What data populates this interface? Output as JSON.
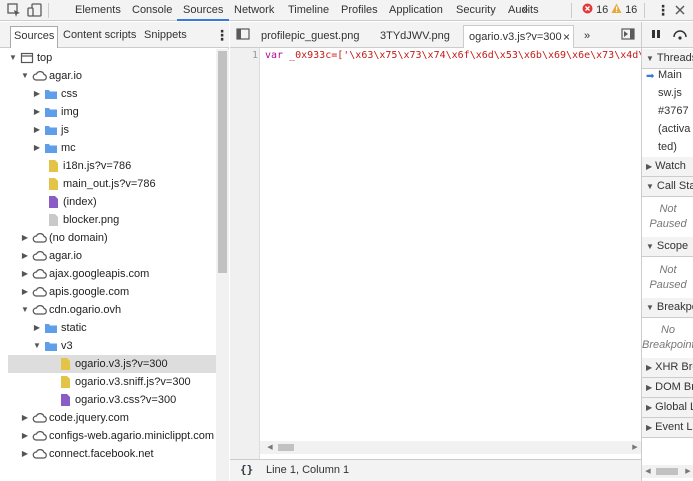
{
  "toolbar": {
    "tabs": [
      "Elements",
      "Console",
      "Sources",
      "Network",
      "Timeline",
      "Profiles",
      "Application",
      "Security",
      "Audits"
    ],
    "active_tab": "Sources",
    "more": "»",
    "errors_count": "16",
    "warnings_count": "16",
    "menu": "⋮"
  },
  "navigator": {
    "tabs": [
      "Sources",
      "Content scripts",
      "Snippets"
    ],
    "active_tab": "Sources",
    "menu": "⋮",
    "tree": [
      {
        "label": "top",
        "type": "frame",
        "level": 0,
        "expanded": true
      },
      {
        "label": "agar.io",
        "type": "domain",
        "level": 1,
        "expanded": true
      },
      {
        "label": "css",
        "type": "folder",
        "level": 2,
        "expanded": false
      },
      {
        "label": "img",
        "type": "folder",
        "level": 2,
        "expanded": false
      },
      {
        "label": "js",
        "type": "folder",
        "level": 2,
        "expanded": false
      },
      {
        "label": "mc",
        "type": "folder",
        "level": 2,
        "expanded": false
      },
      {
        "label": "i18n.js?v=786",
        "type": "file-js",
        "level": 2
      },
      {
        "label": "main_out.js?v=786",
        "type": "file-js",
        "level": 2
      },
      {
        "label": "(index)",
        "type": "file-doc",
        "level": 2
      },
      {
        "label": "blocker.png",
        "type": "file-img",
        "level": 2
      },
      {
        "label": "(no domain)",
        "type": "domain",
        "level": 1,
        "expanded": false
      },
      {
        "label": "agar.io",
        "type": "domain",
        "level": 1,
        "expanded": false
      },
      {
        "label": "ajax.googleapis.com",
        "type": "domain",
        "level": 1,
        "expanded": false
      },
      {
        "label": "apis.google.com",
        "type": "domain",
        "level": 1,
        "expanded": false
      },
      {
        "label": "cdn.ogario.ovh",
        "type": "domain",
        "level": 1,
        "expanded": true
      },
      {
        "label": "static",
        "type": "folder",
        "level": 2,
        "expanded": false
      },
      {
        "label": "v3",
        "type": "folder",
        "level": 2,
        "expanded": true
      },
      {
        "label": "ogario.v3.js?v=300",
        "type": "file-js",
        "level": 3,
        "selected": true
      },
      {
        "label": "ogario.v3.sniff.js?v=300",
        "type": "file-js",
        "level": 3
      },
      {
        "label": "ogario.v3.css?v=300",
        "type": "file-doc",
        "level": 3
      },
      {
        "label": "code.jquery.com",
        "type": "domain",
        "level": 1,
        "expanded": false
      },
      {
        "label": "configs-web.agario.miniclippt.com",
        "type": "domain",
        "level": 1,
        "expanded": false
      },
      {
        "label": "connect.facebook.net",
        "type": "domain",
        "level": 1,
        "expanded": false
      }
    ]
  },
  "editor": {
    "tabs": [
      "profilepic_guest.png",
      "3TYdJWV.png",
      "ogario.v3.js?v=300"
    ],
    "active_tab": "ogario.v3.js?v=300",
    "close": "×",
    "more": "»",
    "line_number": "1",
    "code_keyword": "var",
    "code_rest": " _0x933c=['\\x63\\x75\\x73\\x74\\x6f\\x6d\\x53\\x6b\\x69\\x6e\\x73\\x4d\\x61",
    "pretty_print": "{}",
    "status": "Line 1, Column 1"
  },
  "debugger": {
    "sections": {
      "threads": "Threads",
      "watch": "Watch",
      "call_stack": "Call Stack",
      "scope": "Scope",
      "breakpoints": "Breakpoints",
      "xhr": "XHR Breakpoints",
      "dom": "DOM Breakpoints",
      "global": "Global Listeners",
      "event": "Event Listener Breakpoints"
    },
    "thread_main": "Main",
    "thread_lines": [
      "sw.js",
      "#3767",
      "(activa",
      "ted)"
    ],
    "not_paused_1": "Not",
    "not_paused_2": "Paused",
    "no_bp_1": "No",
    "no_bp_2": "Breakpoints"
  },
  "colors": {
    "accent": "#3879d9",
    "folder": "#5f9ee8",
    "js_file": "#e3c446",
    "doc_file": "#8a5cc6",
    "error": "#e03a3a",
    "warning": "#e9a93a"
  }
}
